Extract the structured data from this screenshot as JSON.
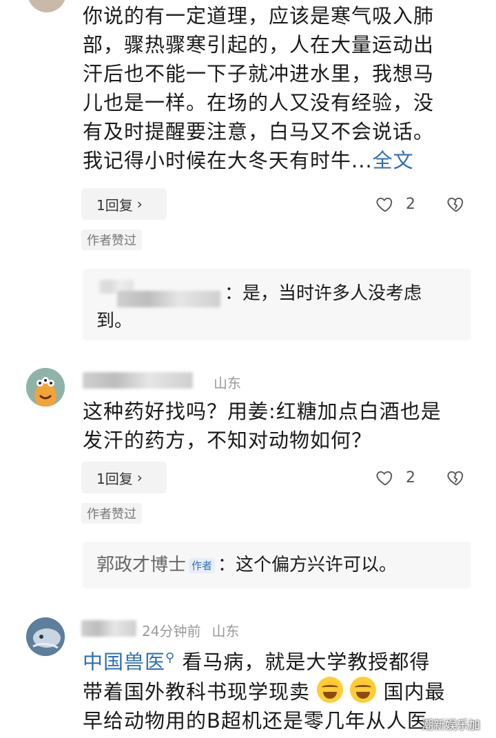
{
  "comment1": {
    "lines": [
      "你说的有一定道理，应该是寒气吸入肺",
      "部，骤热骤寒引起的，人在大量运动出",
      "汗后也不能一下子就冲进水里，我想马",
      "儿也是一样。在场的人又没有经验，没",
      "有及时提醒要注意，白马又不会说话。"
    ],
    "last_line": "我记得小时候在大冬天有时牛",
    "ellipsis": "...",
    "more_link": "全文",
    "reply_label": "1回复",
    "like_count": "2",
    "author_liked": "作者赞过",
    "sub_reply_line1": "：是，当时许多人没考虑",
    "sub_reply_line2": "到。"
  },
  "comment2": {
    "location": "山东",
    "lines": [
      "这种药好找吗？用姜:红糖加点白酒也是",
      "发汗的药方，不知对动物如何？"
    ],
    "reply_label": "1回复",
    "like_count": "2",
    "author_liked": "作者赞过",
    "sub_reply_name": "郭政才博士",
    "sub_reply_tag": "作者",
    "sub_reply_text": "：这个偏方兴许可以。"
  },
  "comment3": {
    "time": "24分钟前",
    "location": "山东",
    "link_text": "中国兽医",
    "line1_rest": " 看马病，就是大学教授都得",
    "line2": "带着国外教科书现学现卖",
    "line2_end": " 国内最",
    "line3": "早给动物用的B超机还是零几年从人医"
  },
  "icons": {
    "heart": "heart-outline-icon",
    "dislike": "broken-heart-icon",
    "chevron": "chevron-right-icon",
    "search": "search-icon",
    "emoji": "crying-laughing-emoji-icon"
  },
  "watermark": "潮新娱乐加"
}
